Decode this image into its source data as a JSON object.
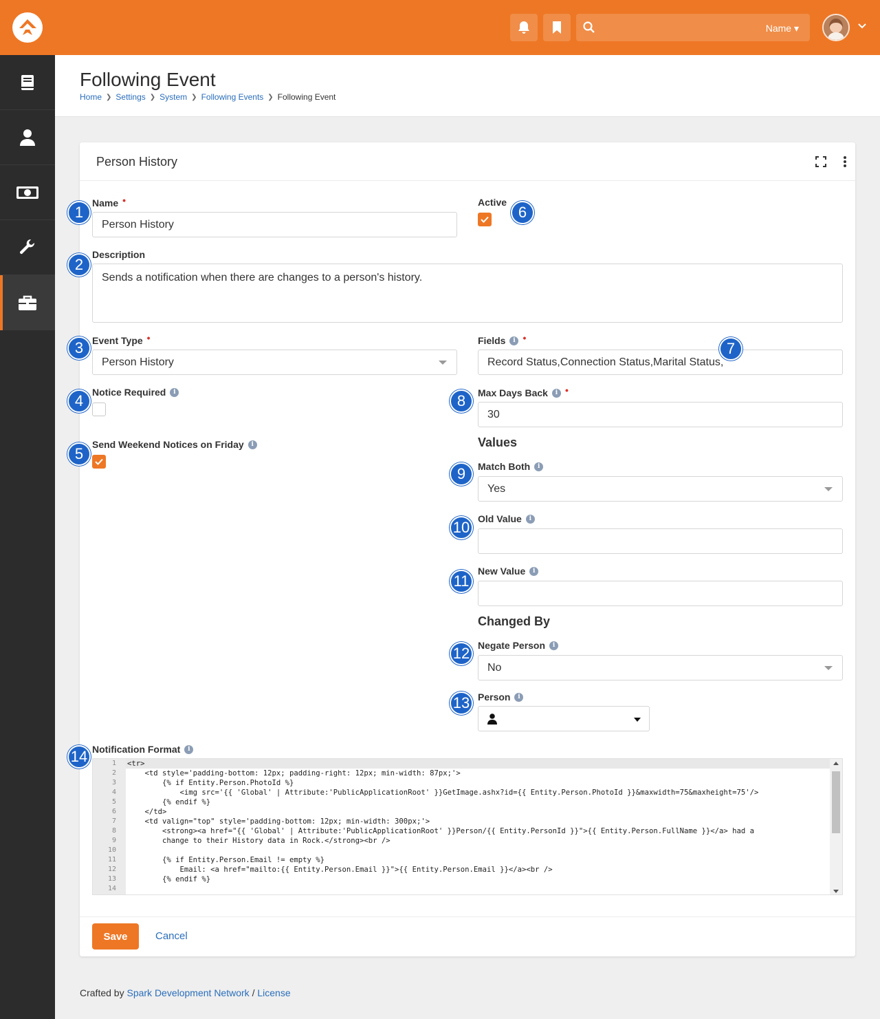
{
  "header": {
    "search_scope": "Name",
    "colors": {
      "brand": "#ee7725",
      "sidebar": "#2c2c2c",
      "link": "#2a6ebb",
      "badge": "#1e64c8"
    }
  },
  "sidebar": {
    "items": [
      {
        "icon": "book-icon",
        "active": false
      },
      {
        "icon": "person-icon",
        "active": false
      },
      {
        "icon": "money-icon",
        "active": false
      },
      {
        "icon": "wrench-icon",
        "active": false
      },
      {
        "icon": "briefcase-icon",
        "active": true
      }
    ]
  },
  "page": {
    "title": "Following Event",
    "breadcrumb": [
      "Home",
      "Settings",
      "System",
      "Following Events",
      "Following Event"
    ]
  },
  "panel": {
    "title": "Person History"
  },
  "form": {
    "name_label": "Name",
    "name_value": "Person History",
    "active_label": "Active",
    "active_checked": true,
    "description_label": "Description",
    "description_value": "Sends a notification when there are changes to a person's history.",
    "event_type_label": "Event Type",
    "event_type_value": "Person History",
    "fields_label": "Fields",
    "fields_value": "Record Status,Connection Status,Marital Status,",
    "notice_required_label": "Notice Required",
    "notice_required_checked": false,
    "max_days_back_label": "Max Days Back",
    "max_days_back_value": "30",
    "send_weekend_label": "Send Weekend Notices on Friday",
    "send_weekend_checked": true,
    "values_heading": "Values",
    "match_both_label": "Match Both",
    "match_both_value": "Yes",
    "old_value_label": "Old Value",
    "old_value_value": "",
    "new_value_label": "New Value",
    "new_value_value": "",
    "changed_by_heading": "Changed By",
    "negate_person_label": "Negate Person",
    "negate_person_value": "No",
    "person_label": "Person",
    "notification_format_label": "Notification Format",
    "save_label": "Save",
    "cancel_label": "Cancel"
  },
  "badges": [
    "1",
    "2",
    "3",
    "4",
    "5",
    "6",
    "7",
    "8",
    "9",
    "10",
    "11",
    "12",
    "13",
    "14"
  ],
  "code": {
    "line_numbers": [
      "1",
      "2",
      "3",
      "4",
      "5",
      "6",
      "7",
      "8",
      "9",
      "10",
      "11",
      "12",
      "13",
      "14"
    ],
    "lines": [
      "<tr>",
      "    <td style='padding-bottom: 12px; padding-right: 12px; min-width: 87px;'>",
      "        {% if Entity.Person.PhotoId %}",
      "            <img src='{{ 'Global' | Attribute:'PublicApplicationRoot' }}GetImage.ashx?id={{ Entity.Person.PhotoId }}&maxwidth=75&maxheight=75'/>",
      "        {% endif %}",
      "    </td>",
      "    <td valign=\"top\" style='padding-bottom: 12px; min-width: 300px;'>",
      "        <strong><a href=\"{{ 'Global' | Attribute:'PublicApplicationRoot' }}Person/{{ Entity.PersonId }}\">{{ Entity.Person.FullName }}</a> had a",
      "        change to their History data in Rock.</strong><br />",
      "",
      "        {% if Entity.Person.Email != empty %}",
      "            Email: <a href=\"mailto:{{ Entity.Person.Email }}\">{{ Entity.Person.Email }}</a><br />",
      "        {% endif %}",
      ""
    ]
  },
  "footer": {
    "prefix": "Crafted by",
    "org": "Spark Development Network",
    "sep": "/",
    "license": "License"
  }
}
